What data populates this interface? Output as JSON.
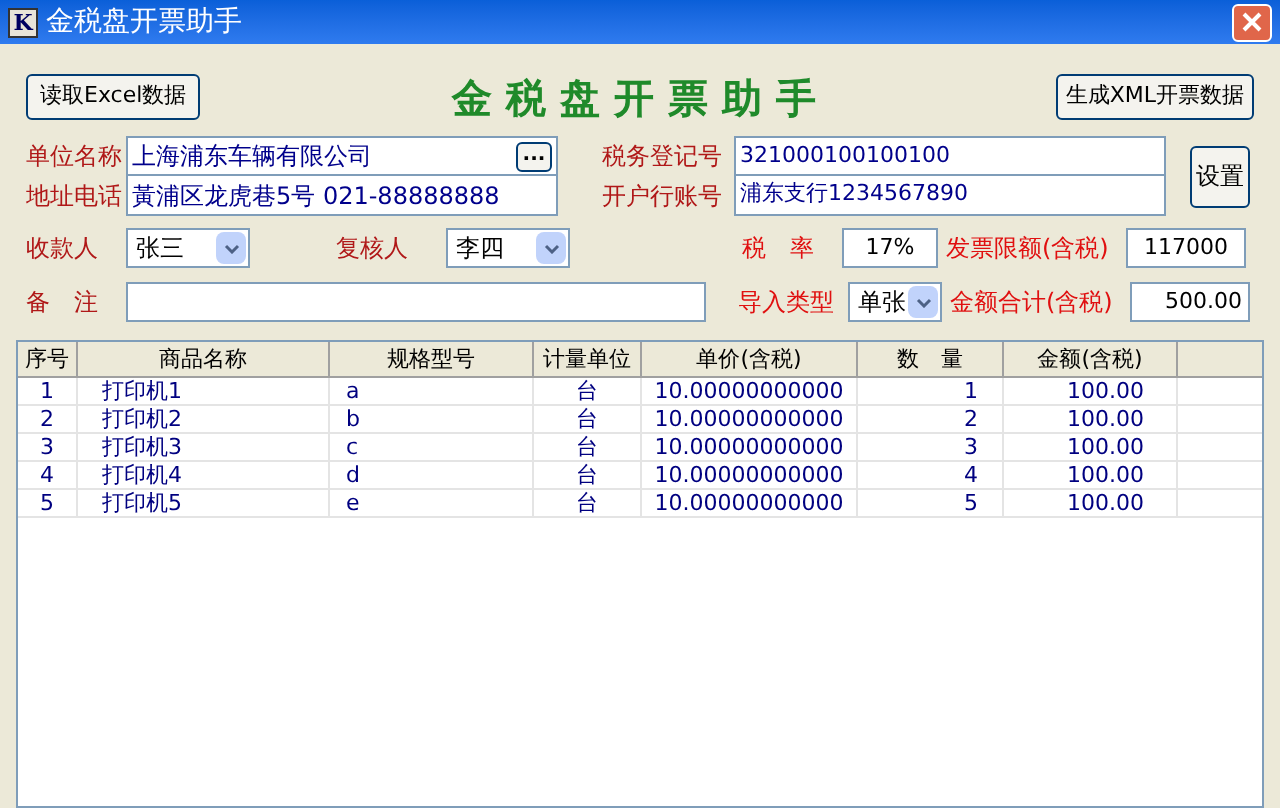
{
  "window": {
    "logo": "K",
    "title": "金税盘开票助手"
  },
  "toolbar": {
    "read_button": "读取Excel数据",
    "heading": "金 税 盘 开 票 助 手",
    "generate_button": "生成XML开票数据"
  },
  "company": {
    "name": {
      "label": "单位名称",
      "value": "上海浦东车辆有限公司",
      "browse": "..."
    },
    "address": {
      "label": "地址电话",
      "value": "黃浦区龙虎巷5号 021-88888888"
    },
    "tax_no": {
      "label": "税务登记号",
      "value": "321000100100100"
    },
    "bank": {
      "label": "开户行账号",
      "value": "浦东支行1234567890"
    },
    "settings_button": "设置"
  },
  "payee": {
    "label": "收款人",
    "value": "张三"
  },
  "reviewer": {
    "label": "复核人",
    "value": "李四"
  },
  "tax_rate": {
    "label": "税　率",
    "value": "17%"
  },
  "invoice_limit": {
    "label": "发票限额(含税)",
    "value": "117000"
  },
  "remark": {
    "label": "备　注"
  },
  "import_type": {
    "label": "导入类型",
    "value": "单张"
  },
  "total": {
    "label": "金额合计(含税)",
    "value": "500.00"
  },
  "table": {
    "columns": [
      "序号",
      "商品名称",
      "规格型号",
      "计量单位",
      "单价(含税)",
      "数　量",
      "金额(含税)"
    ],
    "rows": [
      [
        "1",
        "打印机1",
        "a",
        "台",
        "10.00000000000",
        "1",
        "100.00"
      ],
      [
        "2",
        "打印机2",
        "b",
        "台",
        "10.00000000000",
        "2",
        "100.00"
      ],
      [
        "3",
        "打印机3",
        "c",
        "台",
        "10.00000000000",
        "3",
        "100.00"
      ],
      [
        "4",
        "打印机4",
        "d",
        "台",
        "10.00000000000",
        "4",
        "100.00"
      ],
      [
        "5",
        "打印机5",
        "e",
        "台",
        "10.00000000000",
        "5",
        "100.00"
      ]
    ]
  }
}
